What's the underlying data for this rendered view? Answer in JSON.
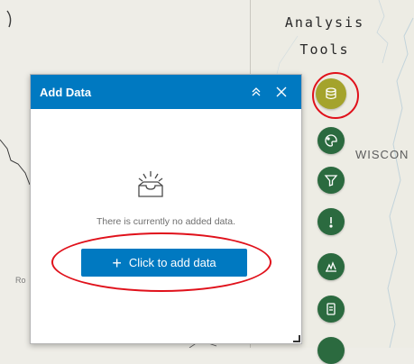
{
  "map": {
    "state_label": "WISCON",
    "place_label": "Ro"
  },
  "analysis_panel": {
    "title_line1": "Analysis",
    "title_line2": "Tools",
    "tools": [
      {
        "icon": "database-icon",
        "active": true
      },
      {
        "icon": "palette-icon",
        "active": false
      },
      {
        "icon": "filter-icon",
        "active": false
      },
      {
        "icon": "alert-icon",
        "active": false
      },
      {
        "icon": "chart-icon",
        "active": false
      },
      {
        "icon": "print-icon",
        "active": false
      }
    ]
  },
  "add_data_dialog": {
    "title": "Add Data",
    "empty_message": "There is currently no added data.",
    "add_button_label": "Click to add data",
    "add_button_icon": "+"
  },
  "colors": {
    "header_blue": "#0079c1",
    "tool_green": "#2b6a3f",
    "tool_active": "#a4a32c",
    "annotation_red": "#e0111b"
  }
}
